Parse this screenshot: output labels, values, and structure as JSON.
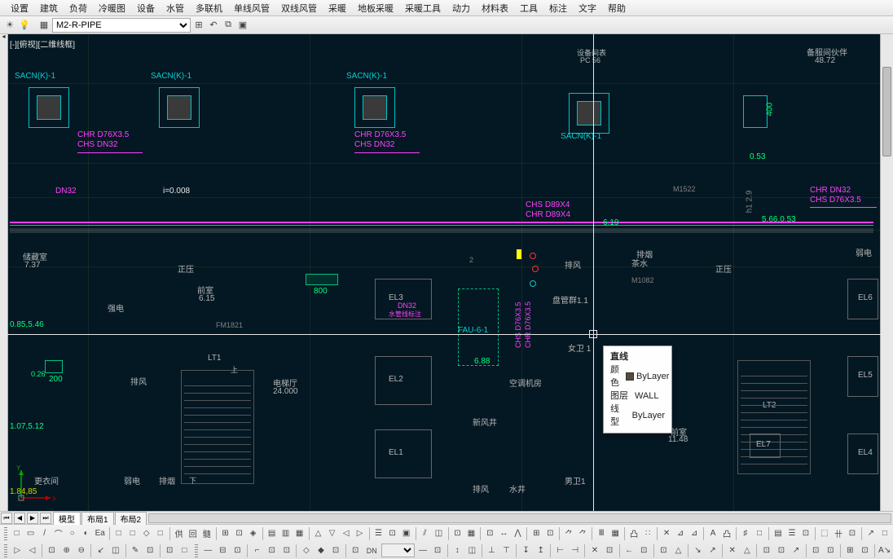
{
  "menu": [
    "设置",
    "建筑",
    "负荷",
    "冷暖图",
    "设备",
    "水管",
    "多联机",
    "单线风管",
    "双线风管",
    "采暖",
    "地板采暖",
    "采暖工具",
    "动力",
    "材料表",
    "工具",
    "标注",
    "文字",
    "帮助"
  ],
  "layerbar": {
    "current_layer": "M2-R-PIPE",
    "icons": [
      "sun-icon",
      "lightbulb-icon",
      "freeze-icon",
      "lock-icon",
      "color-icon",
      "layer-iso-icon",
      "layer-off-icon",
      "layer-prev-icon"
    ]
  },
  "view_tab_label": "[-][俯视][二维线框]",
  "annotations": {
    "sacn1": "SACN(K)-1",
    "sacn2": "SACN(K)-1",
    "sacn3": "SACN(K)-1",
    "sacn4": "SACN(K)-1",
    "chr1a": "CHR D76X3.5",
    "chr1b": "CHS DN32",
    "chr2a": "CHR D76X3.5",
    "chr2b": "CHS DN32",
    "chr_r1": "CHR DN32",
    "chr_r2": "CHS D76X3.5",
    "chs_mid": "CHS D89X4",
    "chr_mid": "CHR D89X4",
    "dn32": "DN32",
    "islope": "i=0.008",
    "pf": "排风",
    "pf2": "排风",
    "pf3": "排风",
    "py": "排烟",
    "cs": "茶水",
    "nw1": "女卫 1",
    "sj": "水井",
    "br": "备服间伙伴",
    "brv": "48.72",
    "ccs": "储藏室",
    "ccsv": "7.37",
    "qd": "弱电",
    "qd2": "弱电",
    "qd3": "强电",
    "qs": "前室",
    "qsv": "6.15",
    "qs2": "前室",
    "qs2v": "11.48",
    "dt": "电梯厅",
    "dtv": "24.000",
    "lt1": "LT1",
    "lt2": "LT2",
    "up": "上",
    "down": "下",
    "nw2": "男卫1",
    "gyj": "更衣间",
    "kmj": "空调机房",
    "xfj": "新风井",
    "el1": "EL1",
    "el2": "EL2",
    "el3": "EL3",
    "el4": "EL4",
    "el5": "EL5",
    "el6": "EL6",
    "el7": "EL7",
    "fau": "FAU-6-1",
    "v800": "800",
    "v200": "200",
    "v400": "400",
    "v053": "0.53",
    "v026": "0.26",
    "v619": "6.19",
    "v688": "6.88",
    "vdn32b": "DN32",
    "vmkt": "水管线标注",
    "v566": "5.66,0.53",
    "v085": "0.85,5.46",
    "v107": "1.07,5.12",
    "v184": "1.84,85",
    "fm": "FM1821",
    "mk": "M1522",
    "mk2": "M1082",
    "pc": "PC 56",
    "sjm": "设备间表",
    "chsv1": "CHS D76X3.5",
    "chrv1": "CHR D76X3.5",
    "h129": "h1 2.9",
    "mxj": "盘管群1.1"
  },
  "tooltip": {
    "title": "直线",
    "rows": [
      {
        "label": "颜色",
        "value": "ByLayer",
        "swatch": true
      },
      {
        "label": "图层",
        "value": "WALL"
      },
      {
        "label": "线型",
        "value": "ByLayer"
      }
    ]
  },
  "tabs": {
    "model": "模型",
    "layout1": "布局1",
    "layout2": "布局2"
  },
  "toolbars": {
    "row1": [
      "□",
      "▭",
      "/",
      "⌒",
      "○",
      "◐",
      "Ea",
      "|",
      "□",
      "□",
      "◇",
      "□",
      "|",
      "供",
      "回",
      "髓",
      "|",
      "⊞",
      "⊡",
      "◈",
      "|",
      "▤",
      "▥",
      "▦",
      "|",
      "△",
      "▽",
      "◁",
      "▷",
      "|",
      "☰",
      "⊡",
      "▣",
      "|",
      "⫽",
      "◫",
      "|",
      "⊡",
      "▦",
      "|",
      "⊡",
      "↔",
      "⋀",
      "|",
      "⊞",
      "⊡",
      "|",
      "⺈",
      "⺈",
      "|",
      "Ⅲ",
      "▦",
      "|",
      "凸",
      "∷",
      "|",
      "✕",
      "⊿",
      "⊿",
      "|",
      "A",
      "凸",
      "|",
      "♯",
      "□",
      "|",
      "▤",
      "☰",
      "⊡",
      "|",
      "⬚",
      "卄",
      "⊡",
      "|",
      "↗",
      "□"
    ],
    "row2_a": [
      "▷",
      "◁",
      "|",
      "⊡",
      "⊕",
      "⊖",
      "|",
      "↙",
      "◫",
      "|",
      "✎",
      "⊡",
      "|",
      "⊡",
      "□"
    ],
    "row2_b": [
      "—",
      "⊟",
      "⊡",
      "|",
      "⌐",
      "⊡",
      "⊡",
      "|",
      "◇",
      "◆",
      "⊡",
      "|",
      "⊡"
    ],
    "row2_dn": "DN",
    "row2_c": [
      "—",
      "⊡",
      "|",
      "↕",
      "◫",
      "|",
      "⊥",
      "⊤",
      "|",
      "↧",
      "↥",
      "|",
      "⊢",
      "⊣",
      "|",
      "✕",
      "⊡",
      "|",
      "←",
      "⊡",
      "|",
      "⊡",
      "△",
      "|",
      "↘",
      "↗",
      "|",
      "✕",
      "△",
      "|",
      "⊡",
      "⊡",
      "↗",
      "|",
      "⊡",
      "⊡",
      "|",
      "⊞",
      "⊡",
      "|",
      "A↘"
    ]
  }
}
